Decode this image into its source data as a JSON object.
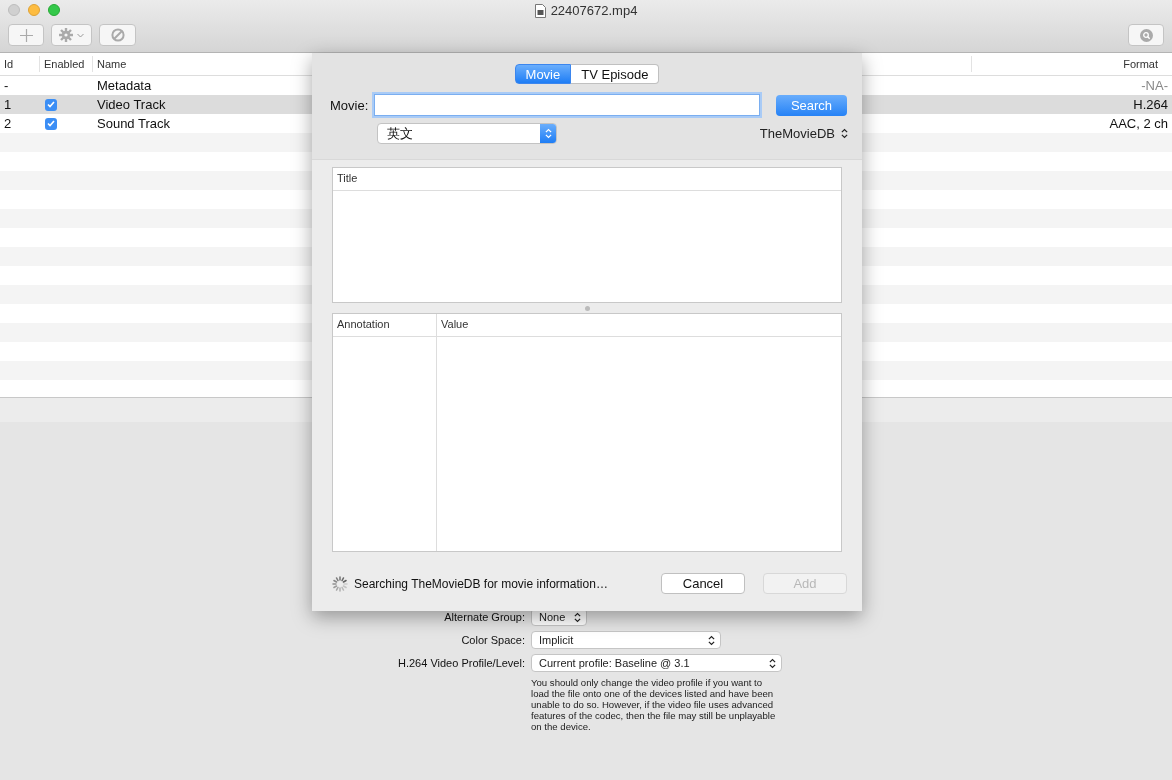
{
  "window": {
    "title": "22407672.mp4"
  },
  "tracks": {
    "columns": [
      "Id",
      "Enabled",
      "Name",
      "Format"
    ],
    "rows": [
      {
        "kind": "metadata",
        "id": "-",
        "name": "Metadata",
        "format": "-NA-",
        "selected": false
      },
      {
        "kind": "track",
        "id": "1",
        "enabled": true,
        "name": "Video Track",
        "format": "H.264",
        "selected": true
      },
      {
        "kind": "track",
        "id": "2",
        "enabled": true,
        "name": "Sound Track",
        "format": "AAC, 2 ch",
        "selected": false
      }
    ]
  },
  "settings": {
    "fields": [
      {
        "label": "Alternate Group:",
        "value": "None"
      },
      {
        "label": "Color Space:",
        "value": "Implicit"
      },
      {
        "label": "H.264 Video Profile/Level:",
        "value": "Current profile: Baseline @ 3.1"
      }
    ],
    "note": "You should only change the video profile if you want to load the file onto one of the devices listed and have been unable to do so.  However, if the video file uses advanced features of the codec, then the file may still be unplayable on the device."
  },
  "sheet": {
    "tabs": [
      {
        "label": "Movie",
        "selected": true
      },
      {
        "label": "TV Episode",
        "selected": false
      }
    ],
    "search_label": "Movie:",
    "search_button": "Search",
    "language": "英文",
    "source": "TheMovieDB",
    "results": {
      "columns": [
        "Title"
      ]
    },
    "details": {
      "columns": [
        "Annotation",
        "Value"
      ]
    },
    "status": "Searching TheMovieDB for movie information…",
    "buttons": [
      {
        "label": "Cancel",
        "disabled": false
      },
      {
        "label": "Add",
        "disabled": true
      }
    ]
  }
}
